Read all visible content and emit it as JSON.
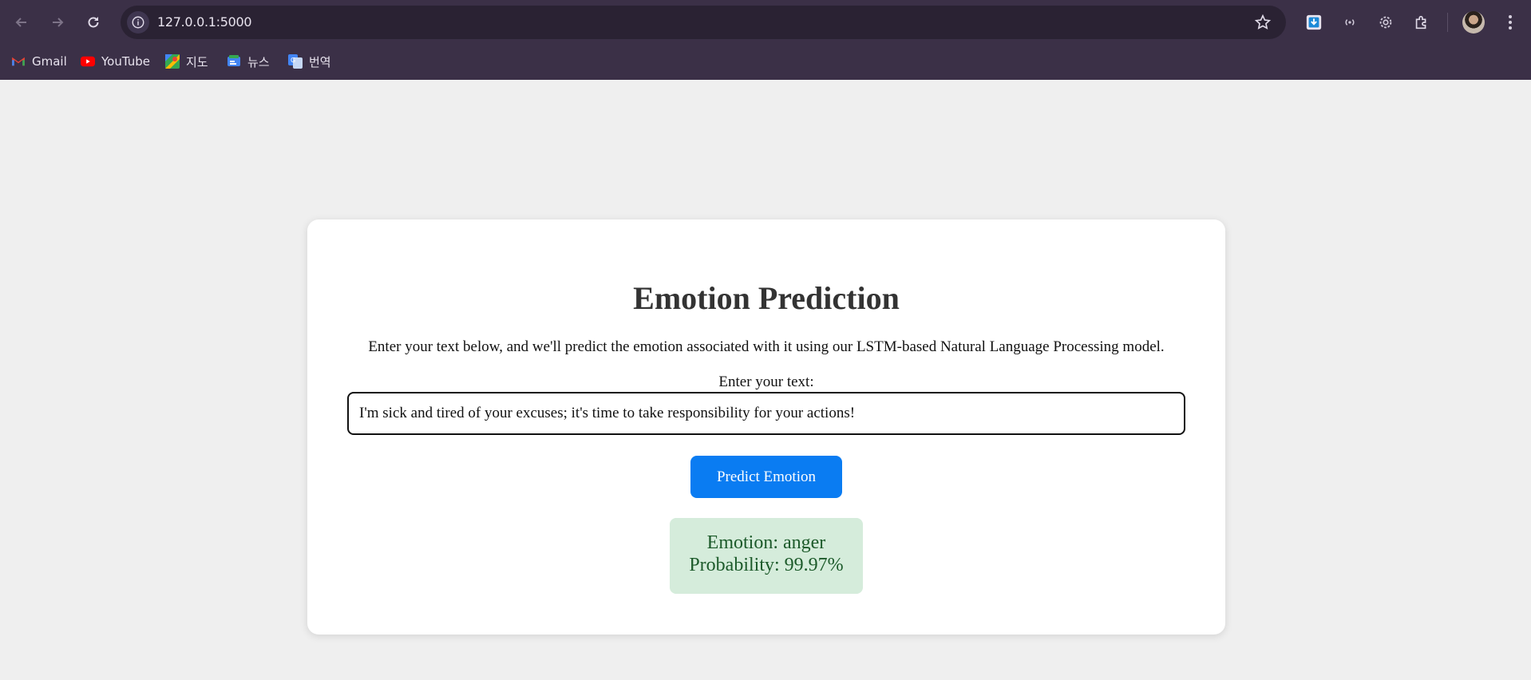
{
  "browser": {
    "url": "127.0.0.1:5000",
    "bookmarks": [
      {
        "label": "Gmail",
        "icon": "gmail-icon"
      },
      {
        "label": "YouTube",
        "icon": "youtube-icon"
      },
      {
        "label": "지도",
        "icon": "maps-icon"
      },
      {
        "label": "뉴스",
        "icon": "news-icon"
      },
      {
        "label": "번역",
        "icon": "translate-icon"
      }
    ],
    "colors": {
      "chrome": "#3b3047",
      "omnibox": "#2a2233"
    }
  },
  "page": {
    "title": "Emotion Prediction",
    "description": "Enter your text below, and we'll predict the emotion associated with it using our LSTM-based Natural Language Processing model.",
    "input_label": "Enter your text:",
    "input_value": "I'm sick and tired of your excuses; it's time to take responsibility for your actions!",
    "button_label": "Predict Emotion",
    "result": {
      "emotion": "Emotion: anger",
      "probability": "Probability: 99.97%"
    },
    "colors": {
      "button": "#0a7cf2",
      "result_bg": "#d5ecdb",
      "result_text": "#1c5a2a"
    }
  }
}
